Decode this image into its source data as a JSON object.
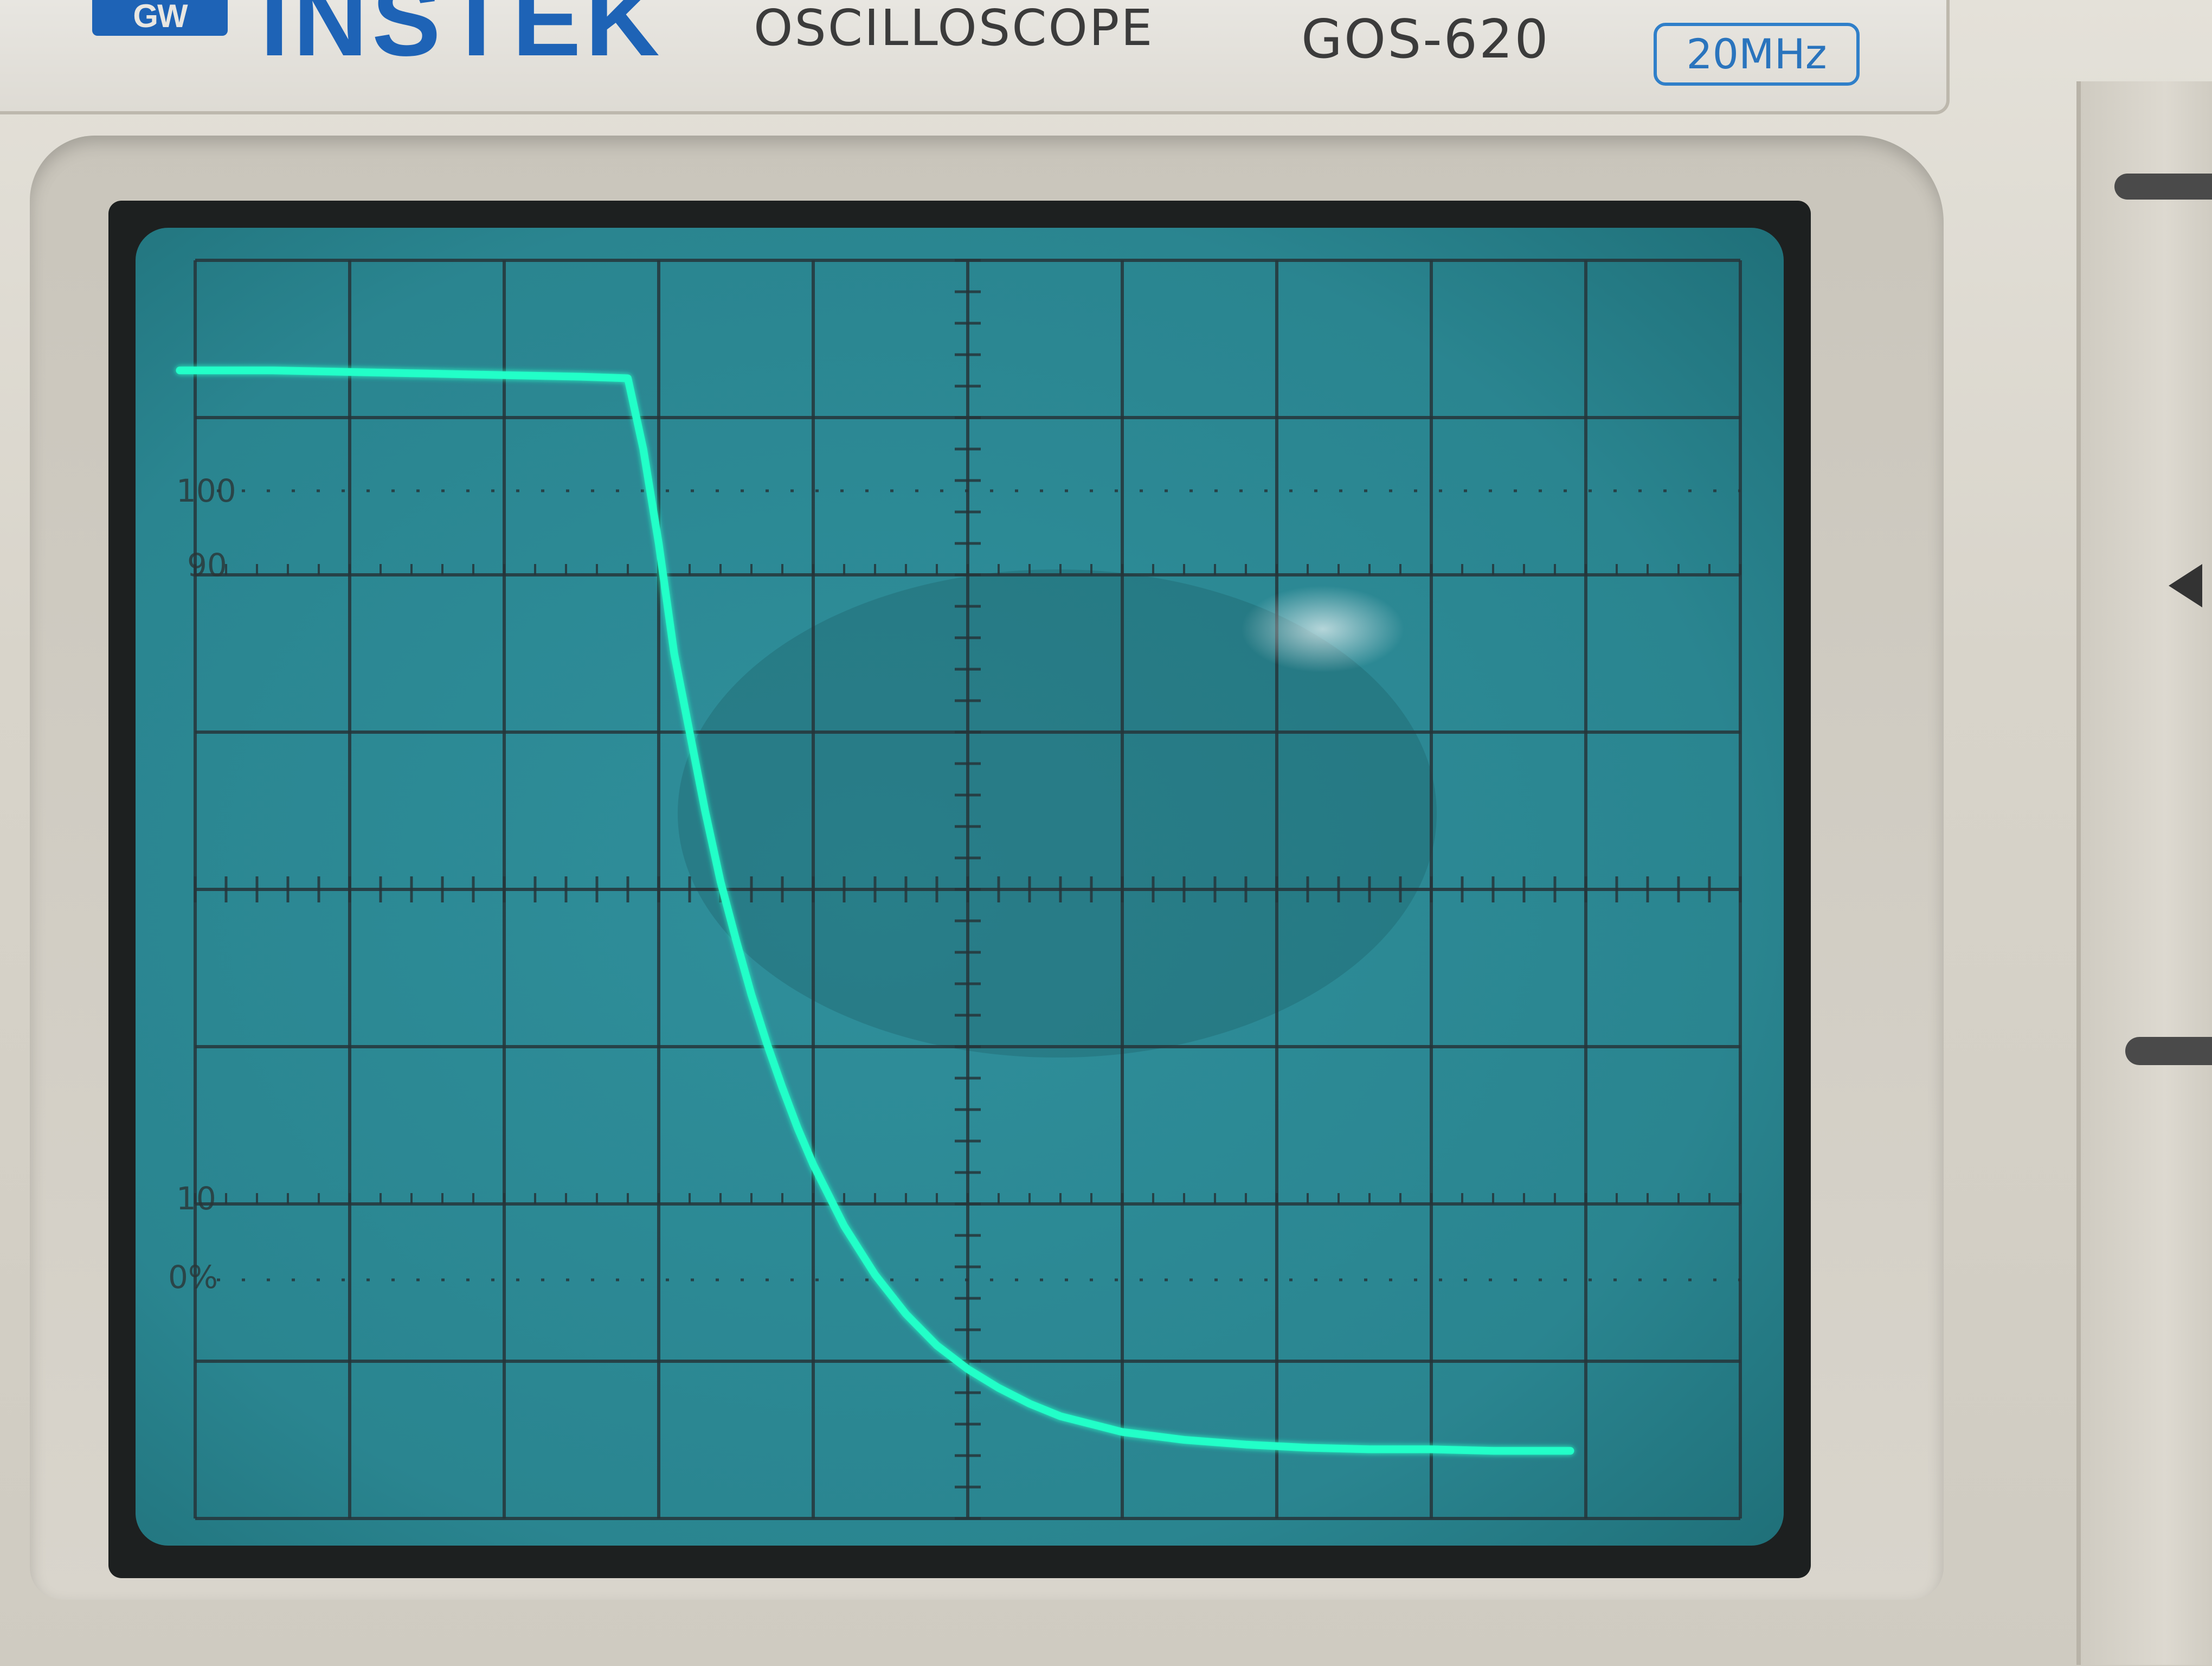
{
  "brand": {
    "badge": "GW",
    "name": "INSTEK"
  },
  "device": {
    "type": "OSCILLOSCOPE",
    "model": "GOS-620",
    "bandwidth": "20MHz"
  },
  "graticule": {
    "major_divisions_x": 10,
    "major_divisions_y": 8,
    "labels": {
      "top_percent": "100",
      "upper_level": "90",
      "lower_level": "10",
      "zero_percent": "0%"
    }
  },
  "colors": {
    "screen": "#2f8f9b",
    "screen_dark": "#1f6f78",
    "grid": "#26353a",
    "trace": "#22ffc8",
    "bezel": "#d8d4ca"
  },
  "chart_data": {
    "type": "line",
    "title": "",
    "xlabel": "",
    "ylabel": "",
    "xlim": [
      0,
      10
    ],
    "ylim": [
      0,
      8
    ],
    "grid": true,
    "x": [
      -0.1,
      0.5,
      1.0,
      1.5,
      2.0,
      2.5,
      2.8,
      2.9,
      3.0,
      3.1,
      3.2,
      3.3,
      3.4,
      3.5,
      3.6,
      3.7,
      3.8,
      3.9,
      4.0,
      4.2,
      4.4,
      4.6,
      4.8,
      5.0,
      5.2,
      5.4,
      5.6,
      5.8,
      6.0,
      6.4,
      6.8,
      7.2,
      7.6,
      8.0,
      8.4,
      8.9
    ],
    "series": [
      {
        "values": [
          7.3,
          7.3,
          7.29,
          7.28,
          7.27,
          7.26,
          7.25,
          6.8,
          6.2,
          5.5,
          5.0,
          4.5,
          4.05,
          3.68,
          3.33,
          3.02,
          2.74,
          2.48,
          2.25,
          1.86,
          1.55,
          1.3,
          1.1,
          0.95,
          0.83,
          0.73,
          0.65,
          0.6,
          0.55,
          0.5,
          0.47,
          0.45,
          0.44,
          0.44,
          0.43,
          0.43
        ]
      }
    ]
  }
}
